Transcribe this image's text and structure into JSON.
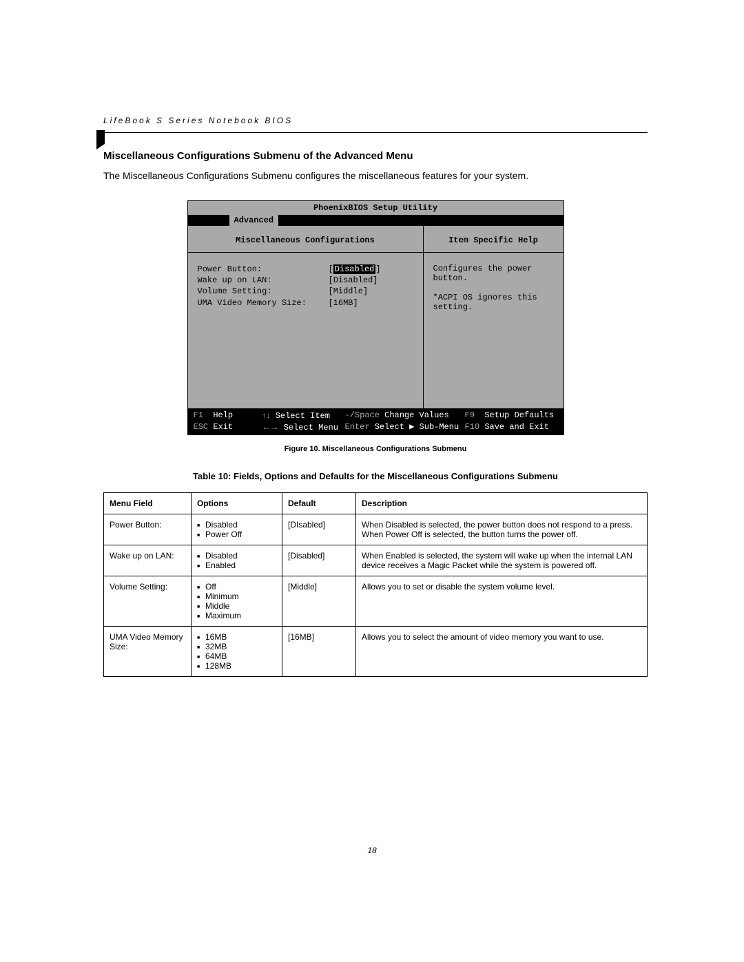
{
  "header": "LifeBook S Series Notebook BIOS",
  "section_title": "Miscellaneous Configurations Submenu of the Advanced Menu",
  "intro": "The Miscellaneous Configurations Submenu configures the miscellaneous features for your system.",
  "bios": {
    "utility_title": "PhoenixBIOS Setup Utility",
    "active_tab": "Advanced",
    "left_header": "Miscellaneous Configurations",
    "right_header": "Item Specific Help",
    "settings": [
      {
        "label": "Power Button:",
        "value": "Disabled",
        "selected": true
      },
      {
        "label": "Wake up on LAN:",
        "value": "[Disabled]",
        "selected": false
      },
      {
        "label": "Volume Setting:",
        "value": "[Middle]",
        "selected": false
      },
      {
        "label": "UMA Video Memory Size:",
        "value": "[16MB]",
        "selected": false
      }
    ],
    "help_lines": [
      "Configures the power",
      "button.",
      "",
      "*ACPI OS ignores this",
      "setting."
    ],
    "footer": {
      "row1": {
        "a_key": "F1",
        "a_lbl": "Help",
        "b_key": "↑↓",
        "b_lbl": "Select Item",
        "c_key": "-/Space",
        "c_lbl": "Change Values",
        "d_key": "F9",
        "d_lbl": "Setup Defaults"
      },
      "row2": {
        "a_key": "ESC",
        "a_lbl": "Exit",
        "b_key": "←→",
        "b_lbl": "Select Menu",
        "c_key": "Enter",
        "c_lbl": "Select ▶ Sub-Menu",
        "d_key": "F10",
        "d_lbl": "Save and Exit"
      }
    }
  },
  "figure_caption": "Figure 10.  Miscellaneous Configurations Submenu",
  "table_title": "Table 10: Fields, Options and Defaults for the Miscellaneous Configurations Submenu",
  "table": {
    "headers": {
      "field": "Menu Field",
      "options": "Options",
      "default": "Default",
      "desc": "Description"
    },
    "rows": [
      {
        "field": "Power Button:",
        "options": [
          "Disabled",
          "Power Off"
        ],
        "default": "[DIsabled]",
        "desc": "When Disabled is selected, the power button does not respond to a press. When Power Off is selected, the button turns the power off."
      },
      {
        "field": "Wake up on LAN:",
        "options": [
          "Disabled",
          "Enabled"
        ],
        "default": "[Disabled]",
        "desc": "When Enabled is selected, the system will wake up when the internal LAN device receives a Magic Packet while the system is powered off."
      },
      {
        "field": "Volume Setting:",
        "options": [
          "Off",
          "Minimum",
          "Middle",
          "Maximum"
        ],
        "default": "[Middle]",
        "desc": "Allows you to set or disable the system volume level."
      },
      {
        "field": "UMA Video Memory Size:",
        "options": [
          "16MB",
          "32MB",
          "64MB",
          "128MB"
        ],
        "default": "[16MB]",
        "desc": "Allows you to select the amount of video memory you want to use."
      }
    ]
  },
  "page_number": "18"
}
